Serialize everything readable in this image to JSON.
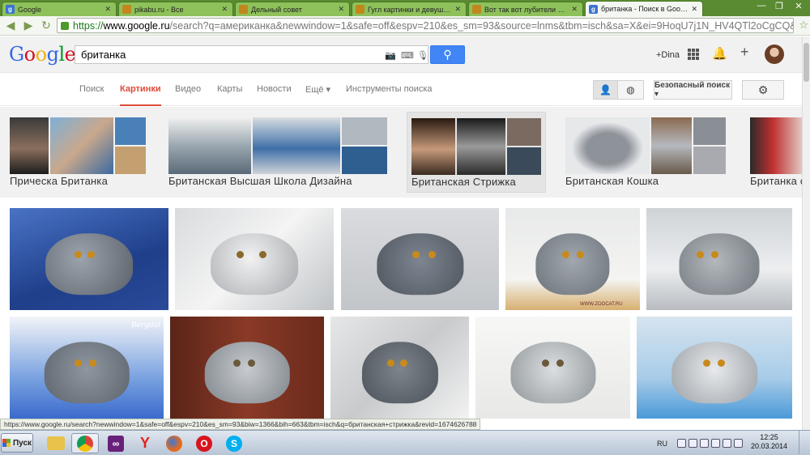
{
  "browser": {
    "tabs": [
      {
        "label": "Google",
        "color": "#3b73d1",
        "glyph": "g"
      },
      {
        "label": "pikabu.ru - Все",
        "color": "#c2871c",
        "glyph": ""
      },
      {
        "label": "Дельный совет",
        "color": "#c2871c",
        "glyph": ""
      },
      {
        "label": "Гугл картинки и девушки.",
        "color": "#c2871c",
        "glyph": ""
      },
      {
        "label": "Вот так вот лубители мед",
        "color": "#c2871c",
        "glyph": ""
      },
      {
        "label": "британка - Поиск в Google",
        "color": "#3b73d1",
        "glyph": "g"
      }
    ],
    "url_scheme": "https://",
    "url_host": "www.google.ru",
    "url_path": "/search?q=американка&newwindow=1&safe=off&espv=210&es_sm=93&source=lnms&tbm=isch&sa=X&ei=9HoqU7j1N_HV4QTl2oCgCQ&ved",
    "status_url": "https://www.google.ru/search?newwindow=1&safe=off&espv=210&es_sm=93&biw=1366&bih=663&tbm=isch&q=британская+стрижка&revid=1674626788"
  },
  "google": {
    "logo_letters": [
      {
        "ch": "G",
        "color": "#3369e8"
      },
      {
        "ch": "o",
        "color": "#d50f25"
      },
      {
        "ch": "o",
        "color": "#eeb211"
      },
      {
        "ch": "g",
        "color": "#3369e8"
      },
      {
        "ch": "l",
        "color": "#009925"
      },
      {
        "ch": "e",
        "color": "#d50f25"
      }
    ],
    "query": "британка",
    "user_name": "+Dina",
    "tabs": [
      "Поиск",
      "Картинки",
      "Видео",
      "Карты",
      "Новости",
      "Ещё ▾",
      "Инструменты поиска"
    ],
    "active_tab": "Картинки",
    "safe_search": "Безопасный поиск ▾"
  },
  "related": [
    {
      "label": "Прическа Британка"
    },
    {
      "label": "Британская Высшая Школа Дизайна"
    },
    {
      "label": "Британская Стрижка"
    },
    {
      "label": "Британская Кошка"
    },
    {
      "label": "Британка с"
    }
  ],
  "watermarks": {
    "cat4": "WWW.ZOOCAT.RU",
    "cat6": "Bergdal"
  },
  "taskbar": {
    "start_label": "Пуск",
    "lang": "RU",
    "time": "12:25",
    "date": "20.03.2014"
  }
}
